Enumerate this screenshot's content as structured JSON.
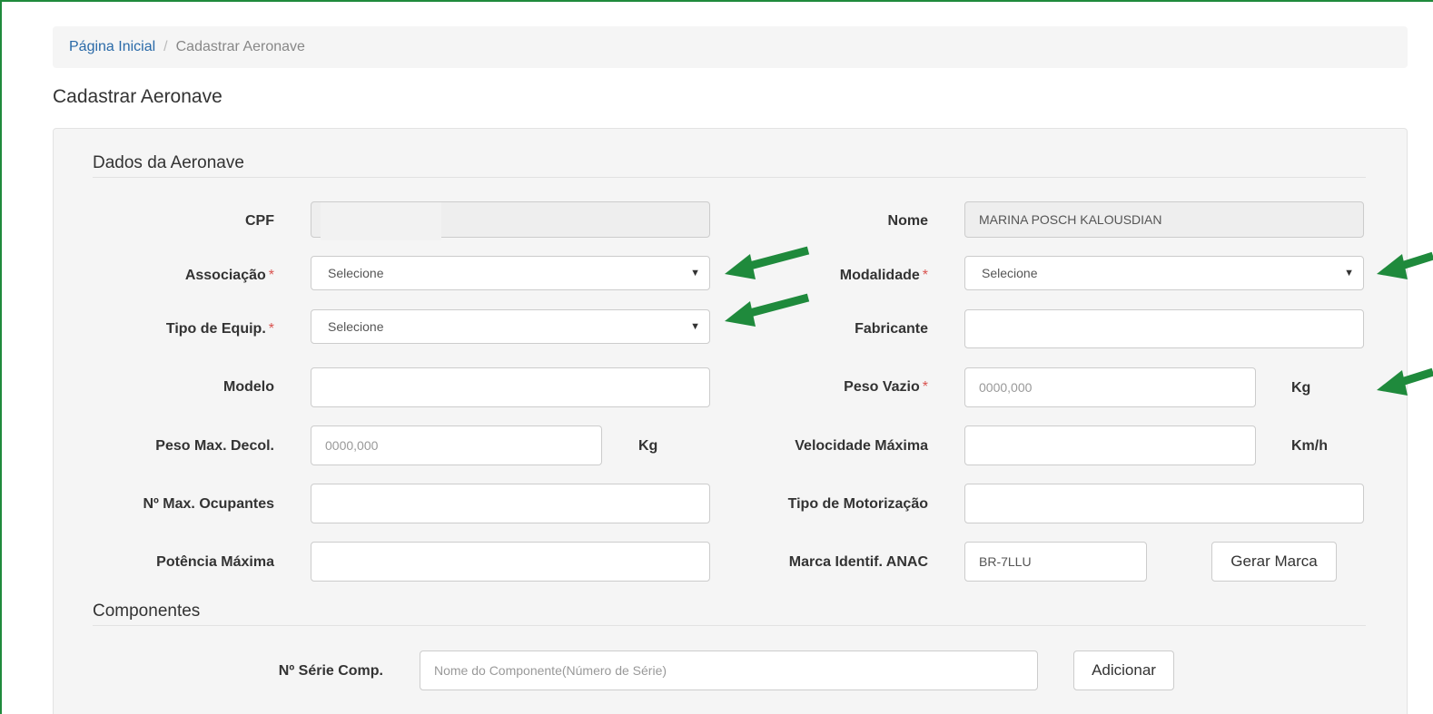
{
  "breadcrumb": {
    "home": "Página Inicial",
    "separator": "/",
    "current": "Cadastrar Aeronave"
  },
  "page_title": "Cadastrar Aeronave",
  "sections": {
    "aircraft": "Dados da Aeronave",
    "components": "Componentes"
  },
  "fields": {
    "cpf": {
      "label": "CPF",
      "value": ""
    },
    "nome": {
      "label": "Nome",
      "value": "MARINA POSCH KALOUSDIAN"
    },
    "associacao": {
      "label": "Associação",
      "required": "*",
      "value": "Selecione"
    },
    "modalidade": {
      "label": "Modalidade",
      "required": "*",
      "value": "Selecione"
    },
    "tipo_equip": {
      "label": "Tipo de Equip.",
      "required": "*",
      "value": "Selecione"
    },
    "fabricante": {
      "label": "Fabricante",
      "value": ""
    },
    "modelo": {
      "label": "Modelo",
      "value": ""
    },
    "peso_vazio": {
      "label": "Peso Vazio",
      "required": "*",
      "placeholder": "0000,000",
      "unit": "Kg"
    },
    "peso_max_decol": {
      "label": "Peso Max. Decol.",
      "placeholder": "0000,000",
      "unit": "Kg"
    },
    "velocidade_maxima": {
      "label": "Velocidade Máxima",
      "value": "",
      "unit": "Km/h"
    },
    "max_ocupantes": {
      "label": "Nº Max. Ocupantes",
      "value": ""
    },
    "tipo_motorizacao": {
      "label": "Tipo de Motorização",
      "value": ""
    },
    "potencia_maxima": {
      "label": "Potência Máxima",
      "value": ""
    },
    "marca_anac": {
      "label": "Marca Identif. ANAC",
      "value": "BR-7LLU",
      "button": "Gerar Marca"
    },
    "serie_comp": {
      "label": "Nº Série Comp.",
      "placeholder": "Nome do Componente(Número de Série)",
      "button": "Adicionar"
    }
  },
  "colors": {
    "accent_arrow": "#1f8a3c",
    "link": "#2a6aa8",
    "required": "#d9534f"
  },
  "icons": {
    "dropdown": "caret-down-icon",
    "annotation": "arrow-left-icon"
  }
}
